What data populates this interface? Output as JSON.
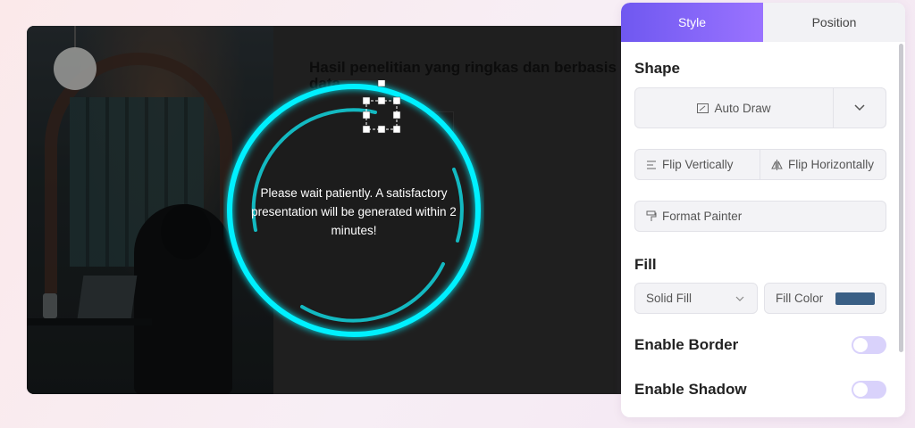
{
  "slide": {
    "title": "Hasil penelitian yang ringkas dan berbasis data"
  },
  "loader": {
    "message": "Please wait patiently. A satisfactory presentation will be generated within 2 minutes!",
    "ring_color": "#00f0ff"
  },
  "panel": {
    "tabs": [
      {
        "label": "Style",
        "active": true
      },
      {
        "label": "Position",
        "active": false
      }
    ],
    "shape": {
      "title": "Shape",
      "auto_draw_label": "Auto Draw",
      "auto_draw_icon": "auto-draw-icon",
      "dropdown_icon": "chevron-down-icon",
      "flip_vertically_label": "Flip Vertically",
      "flip_horizontally_label": "Flip Horizontally",
      "format_painter_label": "Format Painter"
    },
    "fill": {
      "title": "Fill",
      "type_value": "Solid Fill",
      "color_label": "Fill Color",
      "color_value": "#3a5f85"
    },
    "border": {
      "label": "Enable Border",
      "enabled": false
    },
    "shadow": {
      "label": "Enable Shadow",
      "enabled": false
    },
    "accent_color": "#7a5ff3"
  }
}
